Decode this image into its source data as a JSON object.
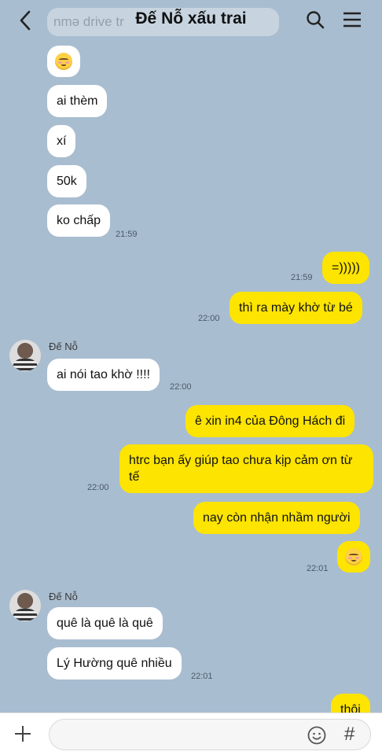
{
  "header": {
    "title": "Đế Nỗ xấu trai",
    "ghost_text": "nmə drive tr"
  },
  "messages": {
    "m1": {
      "text": ""
    },
    "m2": {
      "text": "ai thèm"
    },
    "m3": {
      "text": "xí"
    },
    "m4": {
      "text": "50k"
    },
    "m5": {
      "text": "ko chấp",
      "time": "21:59"
    },
    "m6": {
      "text": "=)))))",
      "time": "21:59"
    },
    "m7": {
      "text": "thì ra mày khờ từ bé",
      "time": "22:00"
    },
    "m8": {
      "sender": "Đế Nỗ",
      "text": "ai nói tao khờ !!!!",
      "time": "22:00"
    },
    "m9": {
      "text": "ê xin in4 của Đông Hách đi"
    },
    "m10": {
      "text": "htrc bạn ấy giúp tao chưa kịp cảm ơn từ tế",
      "time": "22:00"
    },
    "m11": {
      "text": "nay còn nhận nhầm người"
    },
    "m12": {
      "text": "",
      "time": "22:01"
    },
    "m13": {
      "sender": "Đế Nỗ",
      "text": "quê là quê là quê"
    },
    "m14": {
      "text": "Lý Hường quê nhiều",
      "time": "22:01"
    },
    "m15": {
      "text": "thôi"
    }
  },
  "composer": {
    "placeholder": ""
  },
  "icons": [
    "back-arrow-icon",
    "search-icon",
    "menu-icon",
    "plus-icon",
    "emoji-icon",
    "hashtag-icon"
  ],
  "colors": {
    "background": "#a9bdd0",
    "incoming": "#ffffff",
    "outgoing": "#fde401"
  }
}
